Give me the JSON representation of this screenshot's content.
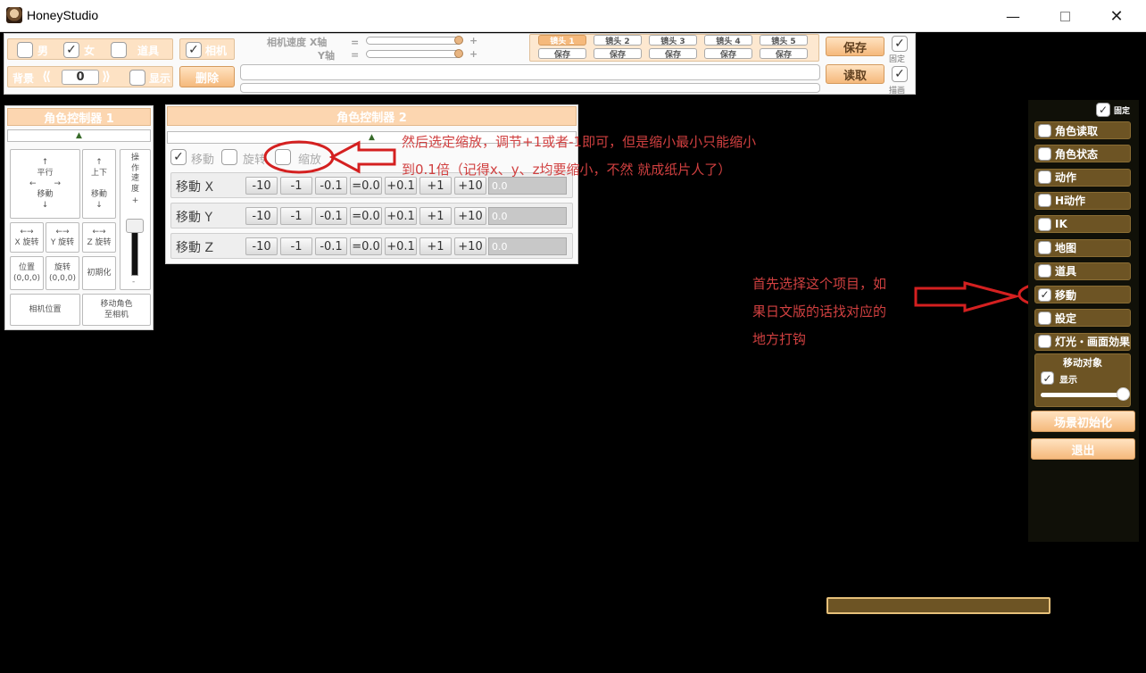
{
  "window": {
    "title": "HoneyStudio",
    "minimize_icon": "minimize-icon",
    "maximize_icon": "maximize-icon",
    "close_icon": "close-icon"
  },
  "toolbar": {
    "male_label": "男",
    "female_label": "女",
    "female_checked": "✓",
    "item_label": "道具",
    "camera_label": "相机",
    "camera_checked": "✓",
    "camera_speed_label": "相机速度 X轴",
    "y_axis_label": "Y轴",
    "equals": "=",
    "plus": "+",
    "background_label": "背景",
    "background_value": "0",
    "show_label": "显示",
    "delete_label": "删除",
    "camera_tabs": [
      "镜头 1",
      "镜头 2",
      "镜头 3",
      "镜头 4",
      "镜头 5"
    ],
    "camera_save": "保存",
    "save_label": "保存",
    "load_label": "读取",
    "fix_label": "固定",
    "draw_label": "描画",
    "fix_checked": "✓",
    "draw_checked": "✓"
  },
  "panel1": {
    "title": "角色控制器 1",
    "cells": {
      "parallel": "平行",
      "move": "移動",
      "updown": "上下",
      "x_rot": "X 旋转",
      "y_rot": "Y 旋转",
      "z_rot": "Z 旋转",
      "position": "位置",
      "pos_val": "(0,0,0)",
      "rotation": "旋转",
      "rot_val": "(0,0,0)",
      "init": "初期化",
      "cam_pos": "相机位置",
      "move_char": "移动角色",
      "to_cam": "至相机",
      "speed": "操作速度",
      "plus": "+",
      "minus": "-"
    }
  },
  "panel2": {
    "title": "角色控制器 2",
    "tab_move": "移動",
    "tab_rotate": "旋转",
    "tab_scale": "缩放",
    "tab_move_checked": "✓",
    "rows": [
      {
        "label": "移動 X",
        "value": "0.0"
      },
      {
        "label": "移動 Y",
        "value": "0.0"
      },
      {
        "label": "移動 Z",
        "value": "0.0"
      }
    ],
    "buttons": [
      "-10",
      "-1",
      "-0.1",
      "=0.0",
      "+0.1",
      "+1",
      "+10"
    ]
  },
  "right_menu": {
    "fix_label": "固定",
    "fix_checked": "✓",
    "items": [
      {
        "label": "角色读取",
        "checked": ""
      },
      {
        "label": "角色状态",
        "checked": ""
      },
      {
        "label": "动作",
        "checked": ""
      },
      {
        "label": "H动作",
        "checked": ""
      },
      {
        "label": "IK",
        "checked": ""
      },
      {
        "label": "地图",
        "checked": ""
      },
      {
        "label": "道具",
        "checked": ""
      },
      {
        "label": "移動",
        "checked": "✓"
      },
      {
        "label": "設定",
        "checked": ""
      },
      {
        "label": "灯光・画面効果",
        "checked": ""
      }
    ],
    "move_target_title": "移动对象",
    "move_target_show": "显示",
    "move_target_checked": "✓",
    "move_target_slider_level": 1.0,
    "scene_init": "场景初始化",
    "exit": "退出"
  },
  "annotations": {
    "top_line1": "然后选定缩放，调节+1或者-1即可，但是缩小最小只能缩小",
    "top_line2": "到0.1倍（记得x、y、z均要缩小，不然 就成纸片人了）",
    "right_line1": "首先选择这个项目，如",
    "right_line2": "果日文版的话找对应的",
    "right_line3": "地方打钩"
  },
  "colors": {
    "annotation": "#d04040",
    "panel_head": "#fcd6b0",
    "menu_item": "#6d5424",
    "button_orange": "#f5b97c"
  }
}
